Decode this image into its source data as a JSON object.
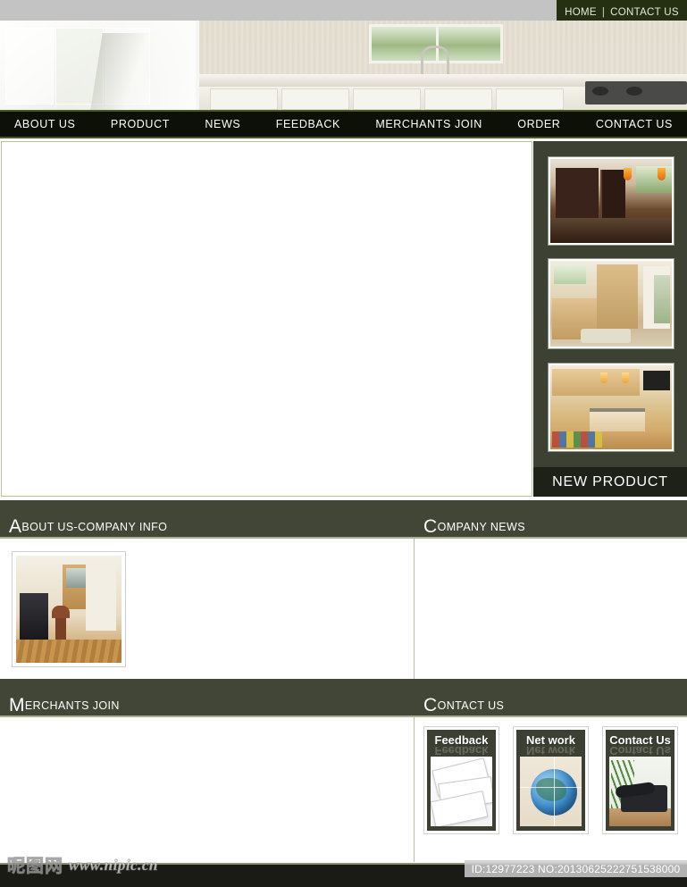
{
  "topbar": {
    "home_label": "HOME",
    "separator": "|",
    "contact_label": "CONTACT US"
  },
  "nav": {
    "items": [
      {
        "label": "ABOUT US"
      },
      {
        "label": "PRODUCT"
      },
      {
        "label": "NEWS"
      },
      {
        "label": "FEEDBACK"
      },
      {
        "label": "MERCHANTS JOIN"
      },
      {
        "label": "ORDER"
      },
      {
        "label": "CONTACT US"
      }
    ]
  },
  "sidebar": {
    "title": "NEW PRODUCT",
    "thumbnails": [
      {
        "name": "dark-cabinet-kitchen"
      },
      {
        "name": "light-wood-vanity"
      },
      {
        "name": "maple-island-kitchen"
      }
    ]
  },
  "panels": {
    "about": {
      "cap": "A",
      "rest": "bout us-company info"
    },
    "news": {
      "cap": "C",
      "rest": "ompany news"
    },
    "merchants": {
      "cap": "M",
      "rest": "erchants join"
    },
    "contact": {
      "cap": "C",
      "rest": "ontact us"
    }
  },
  "contact_cards": [
    {
      "title": "Feedback",
      "image": "envelopes-photo"
    },
    {
      "title": "Net work",
      "image": "globe-photo"
    },
    {
      "title": "Contact Us",
      "image": "desk-phone-photo"
    }
  ],
  "footer": {
    "watermark_cn": "昵图网",
    "watermark_url": "www.nipic.cn",
    "id_text": "ID:12977223 NO:20130625222751538000"
  },
  "colors": {
    "topbar_bg": "#c3c3c3",
    "topbar_links_bg": "#253013",
    "nav_bg": "#0d1006",
    "nav_border": "#4b5a20",
    "panel_head_bg": "#424636",
    "sidebar_bg": "#3d4134",
    "sidebar_title_bg": "#1e2117",
    "divider": "#b9c09e",
    "footer_strip": "#191b14"
  }
}
